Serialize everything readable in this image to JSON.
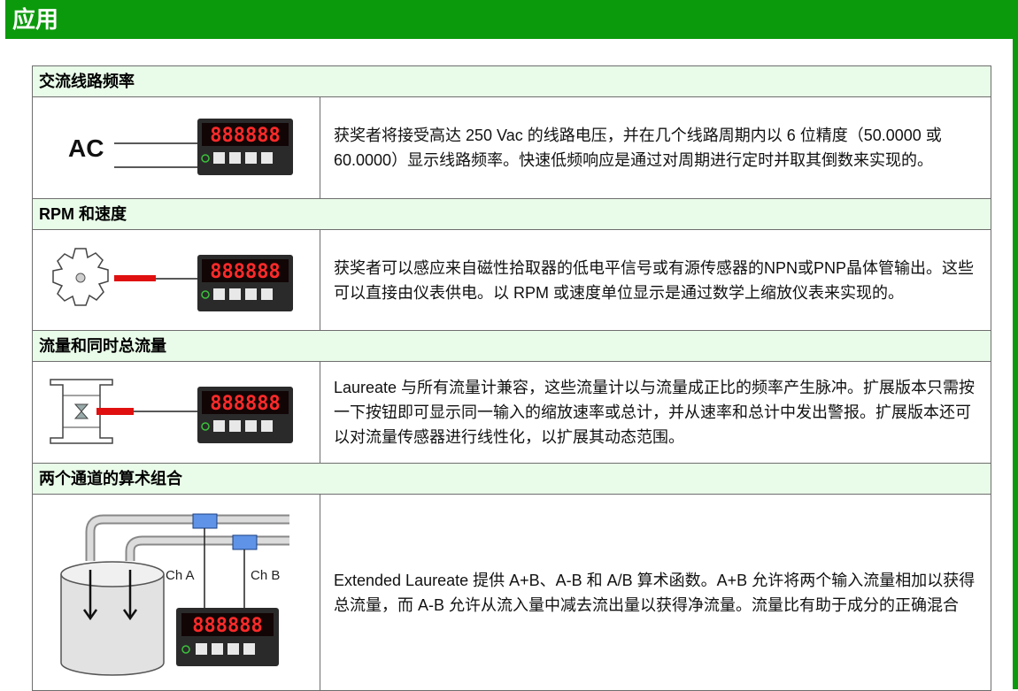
{
  "header": {
    "title": "应用"
  },
  "sections": [
    {
      "heading": "交流线路频率",
      "image_label": "AC",
      "text": "获奖者将接受高达 250 Vac 的线路电压，并在几个线路周期内以 6 位精度（50.0000 或 60.0000）显示线路频率。快速低频响应是通过对周期进行定时并取其倒数来实现的。"
    },
    {
      "heading": "RPM 和速度",
      "text": "获奖者可以感应来自磁性拾取器的低电平信号或有源传感器的NPN或PNP晶体管输出。这些可以直接由仪表供电。以 RPM 或速度单位显示是通过数学上缩放仪表来实现的。"
    },
    {
      "heading": "流量和同时总流量",
      "text": "Laureate 与所有流量计兼容，这些流量计以与流量成正比的频率产生脉冲。扩展版本只需按一下按钮即可显示同一输入的缩放速率或总计，并从速率和总计中发出警报。扩展版本还可以对流量传感器进行线性化，以扩展其动态范围。"
    },
    {
      "heading": "两个通道的算术组合",
      "channel_a": "Ch A",
      "channel_b": "Ch B",
      "text": "Extended Laureate 提供 A+B、A-B 和 A/B 算术函数。A+B 允许将两个输入流量相加以获得总流量，而 A-B 允许从流入量中减去流出量以获得净流量。流量比有助于成分的正确混合"
    }
  ],
  "meter": {
    "display": "888888"
  },
  "colors": {
    "header_green": "#0b9a0b",
    "section_bg": "#e9fbe9",
    "sensor_red": "#e01010",
    "sensor_blue": "#5f93e8",
    "digit_red": "#ff2a2a"
  }
}
